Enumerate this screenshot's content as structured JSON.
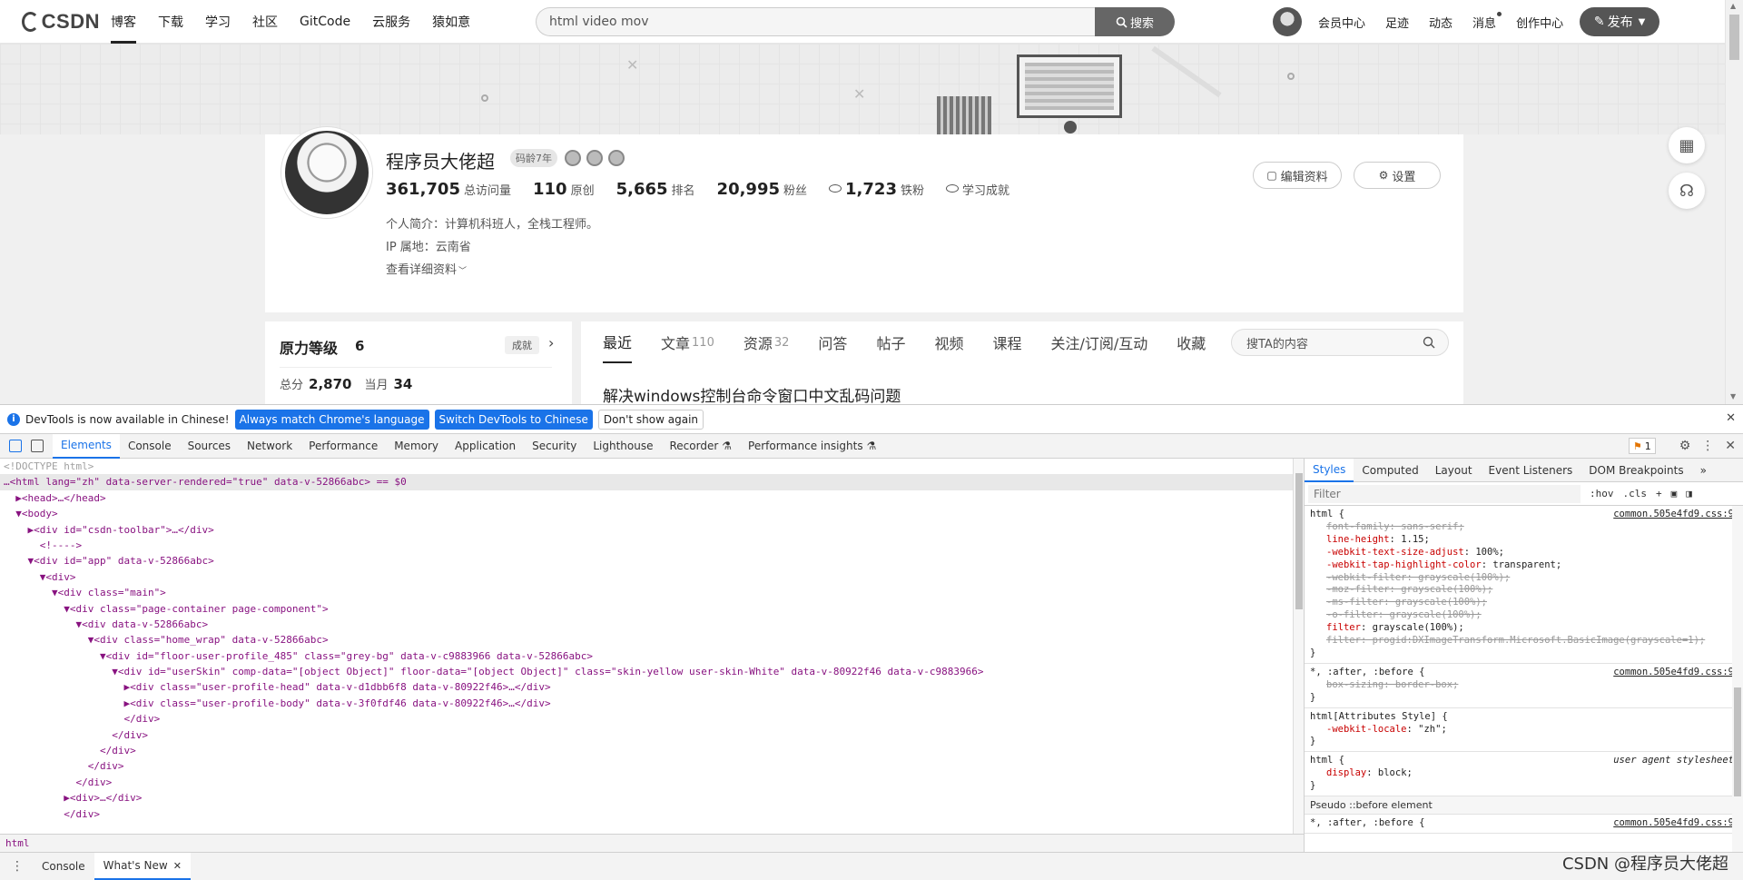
{
  "toolbar": {
    "logo": "CSDN",
    "nav": [
      "博客",
      "下载",
      "学习",
      "社区",
      "GitCode",
      "云服务",
      "猿如意"
    ],
    "search_value": "html video mov",
    "search_button": "搜索",
    "links": [
      "会员中心",
      "足迹",
      "动态",
      "消息",
      "创作中心"
    ],
    "publish": "发布"
  },
  "profile": {
    "name": "程序员大佬超",
    "age_badge": "码龄7年",
    "stats": [
      {
        "num": "361,705",
        "label": "总访问量"
      },
      {
        "num": "110",
        "label": "原创"
      },
      {
        "num": "5,665",
        "label": "排名"
      },
      {
        "num": "20,995",
        "label": "粉丝"
      },
      {
        "num": "1,723",
        "label": "铁粉"
      }
    ],
    "achievement": "学习成就",
    "intro": "个人简介：计算机科班人，全栈工程师。",
    "ip": "IP 属地：云南省",
    "detail": "查看详细资料",
    "edit_button": "编辑资料",
    "settings_button": "设置"
  },
  "level": {
    "title": "原力等级",
    "value": "6",
    "tag": "成就",
    "total_label": "总分",
    "total": "2,870",
    "month_label": "当月",
    "month": "34"
  },
  "content": {
    "tabs": [
      {
        "label": "最近",
        "count": ""
      },
      {
        "label": "文章",
        "count": "110"
      },
      {
        "label": "资源",
        "count": "32"
      },
      {
        "label": "问答",
        "count": ""
      },
      {
        "label": "帖子",
        "count": ""
      },
      {
        "label": "视频",
        "count": ""
      },
      {
        "label": "课程",
        "count": ""
      },
      {
        "label": "关注/订阅/互动",
        "count": ""
      },
      {
        "label": "收藏",
        "count": ""
      }
    ],
    "search_placeholder": "搜TA的内容",
    "first_article": "解决windows控制台命令窗口中文乱码问题"
  },
  "devtools": {
    "infobar": {
      "text": "DevTools is now available in Chinese!",
      "btn1": "Always match Chrome's language",
      "btn2": "Switch DevTools to Chinese",
      "btn3": "Don't show again"
    },
    "tabs": [
      "Elements",
      "Console",
      "Sources",
      "Network",
      "Performance",
      "Memory",
      "Application",
      "Security",
      "Lighthouse",
      "Recorder",
      "Performance insights"
    ],
    "warnings": "1",
    "styles_tabs": [
      "Styles",
      "Computed",
      "Layout",
      "Event Listeners",
      "DOM Breakpoints"
    ],
    "filter_placeholder": "Filter",
    "filter_hov": ":hov",
    "filter_cls": ".cls",
    "breadcrumb": "html",
    "drawer_tabs": [
      "Console",
      "What's New"
    ],
    "pseudo_header": "Pseudo ::before element",
    "elements_lines": [
      "<!DOCTYPE html>",
      "…<html lang=\"zh\" data-server-rendered=\"true\" data-v-52866abc> == $0",
      "  ▶<head>…</head>",
      "  ▼<body>",
      "    ▶<div id=\"csdn-toolbar\">…</div>",
      "      <!---->",
      "    ▼<div id=\"app\" data-v-52866abc>",
      "      ▼<div>",
      "        ▼<div class=\"main\">",
      "          ▼<div class=\"page-container page-component\">",
      "            ▼<div data-v-52866abc>",
      "              ▼<div class=\"home_wrap\" data-v-52866abc>",
      "                ▼<div id=\"floor-user-profile_485\" class=\"grey-bg\" data-v-c9883966 data-v-52866abc>",
      "                  ▼<div id=\"userSkin\" comp-data=\"[object Object]\" floor-data=\"[object Object]\" class=\"skin-yellow user-skin-White\" data-v-80922f46 data-v-c9883966>",
      "                    ▶<div class=\"user-profile-head\" data-v-d1dbb6f8 data-v-80922f46>…</div>",
      "                    ▶<div class=\"user-profile-body\" data-v-3f0fdf46 data-v-80922f46>…</div>",
      "                    </div>",
      "                  </div>",
      "                </div>",
      "              </div>",
      "            </div>",
      "          ▶<div>…</div>",
      "          </div>"
    ],
    "rules": [
      {
        "selector": "html {",
        "source": "common.505e4fd9.css:9",
        "props": [
          {
            "n": "font-family",
            "v": "sans-serif;",
            "strike": true
          },
          {
            "n": "line-height",
            "v": "1.15;",
            "strike": false
          },
          {
            "n": "-webkit-text-size-adjust",
            "v": "100%;",
            "strike": false
          },
          {
            "n": "-webkit-tap-highlight-color",
            "v": "transparent;",
            "strike": false
          },
          {
            "n": "-webkit-filter",
            "v": "grayscale(100%);",
            "strike": true
          },
          {
            "n": "-moz-filter",
            "v": "grayscale(100%);",
            "strike": true
          },
          {
            "n": "-ms-filter",
            "v": "grayscale(100%);",
            "strike": true
          },
          {
            "n": "-o-filter",
            "v": "grayscale(100%);",
            "strike": true
          },
          {
            "n": "filter",
            "v": "grayscale(100%);",
            "strike": false
          },
          {
            "n": "filter",
            "v": "progid:DXImageTransform.Microsoft.BasicImage(grayscale=1);",
            "strike": true
          }
        ]
      },
      {
        "selector": "*, :after, :before {",
        "source": "common.505e4fd9.css:9",
        "props": [
          {
            "n": "box-sizing",
            "v": "border-box;",
            "strike": true
          }
        ]
      },
      {
        "selector": "html[Attributes Style] {",
        "source": "",
        "props": [
          {
            "n": "-webkit-locale",
            "v": "\"zh\";",
            "strike": false
          }
        ]
      },
      {
        "selector": "html {",
        "source": "user agent stylesheet",
        "props": [
          {
            "n": "display",
            "v": "block;",
            "strike": false
          }
        ]
      }
    ],
    "pseudo_rule": {
      "selector": "*, :after, :before {",
      "source": "common.505e4fd9.css:9"
    }
  },
  "watermark": "CSDN @程序员大佬超"
}
